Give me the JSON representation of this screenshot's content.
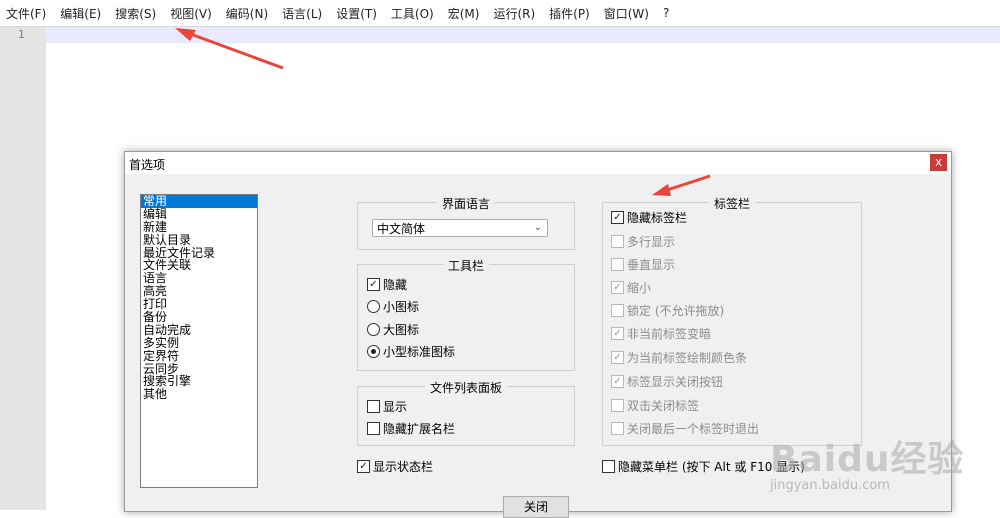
{
  "menubar": {
    "items": [
      "文件(F)",
      "编辑(E)",
      "搜索(S)",
      "视图(V)",
      "编码(N)",
      "语言(L)",
      "设置(T)",
      "工具(O)",
      "宏(M)",
      "运行(R)",
      "插件(P)",
      "窗口(W)",
      "?"
    ]
  },
  "editor": {
    "line_number": "1"
  },
  "dialog": {
    "title": "首选项",
    "close_glyph": "x",
    "categories": [
      "常用",
      "编辑",
      "新建",
      "默认目录",
      "最近文件记录",
      "文件关联",
      "语言",
      "高亮",
      "打印",
      "备份",
      "自动完成",
      "多实例",
      "定界符",
      "云同步",
      "搜索引擎",
      "其他"
    ],
    "selected_category": "常用",
    "ui_language": {
      "label": "界面语言",
      "value": "中文简体"
    },
    "toolbar": {
      "label": "工具栏",
      "hide": "隐藏",
      "small_icons": "小图标",
      "large_icons": "大图标",
      "standard_small_icons": "小型标准图标"
    },
    "doclist": {
      "label": "文件列表面板",
      "show": "显示",
      "hide_ext": "隐藏扩展名栏"
    },
    "show_statusbar": "显示状态栏",
    "tabbar": {
      "label": "标签栏",
      "items": [
        "隐藏标签栏",
        "多行显示",
        "垂直显示",
        "缩小",
        "锁定 (不允许拖放)",
        "非当前标签变暗",
        "为当前标签绘制颜色条",
        "标签显示关闭按钮",
        "双击关闭标签",
        "关闭最后一个标签时退出"
      ]
    },
    "hide_menubar": "隐藏菜单栏 (按下 Alt 或 F10 显示)",
    "close_button": "关闭",
    "check_glyph": "✓"
  },
  "watermark": {
    "main": "Baidu经验",
    "sub": "jingyan.baidu.com"
  },
  "colors": {
    "arrow": "#e8453c",
    "selection": "#0078d7",
    "current_line": "#e8e8ff",
    "close_red": "#c83c3c"
  }
}
